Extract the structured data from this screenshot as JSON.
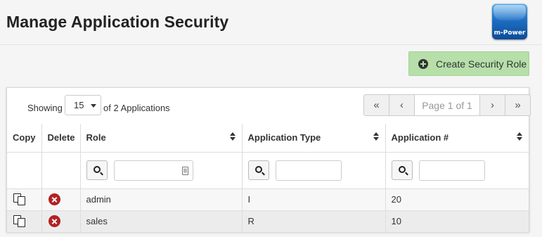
{
  "page": {
    "title": "Manage Application Security"
  },
  "logo": {
    "text": "m-Power",
    "icon": "mpower-logo-icon"
  },
  "actions": {
    "create_label": "Create Security Role",
    "create_icon": "plus-circle-icon",
    "create_color": "#b6dfaa"
  },
  "toolbar": {
    "showing_label": "Showing",
    "page_size": "15",
    "count_label": "of 2 Applications",
    "pager": {
      "first": "«",
      "prev": "‹",
      "info": "Page 1 of 1",
      "next": "›",
      "last": "»"
    }
  },
  "table": {
    "columns": [
      "Copy",
      "Delete",
      "Role",
      "Application Type",
      "Application #"
    ],
    "rows": [
      {
        "role": "admin",
        "app_type": "I",
        "app_num": "20"
      },
      {
        "role": "sales",
        "app_type": "R",
        "app_num": "10"
      }
    ]
  },
  "colors": {
    "delete_icon": "#b32222"
  }
}
